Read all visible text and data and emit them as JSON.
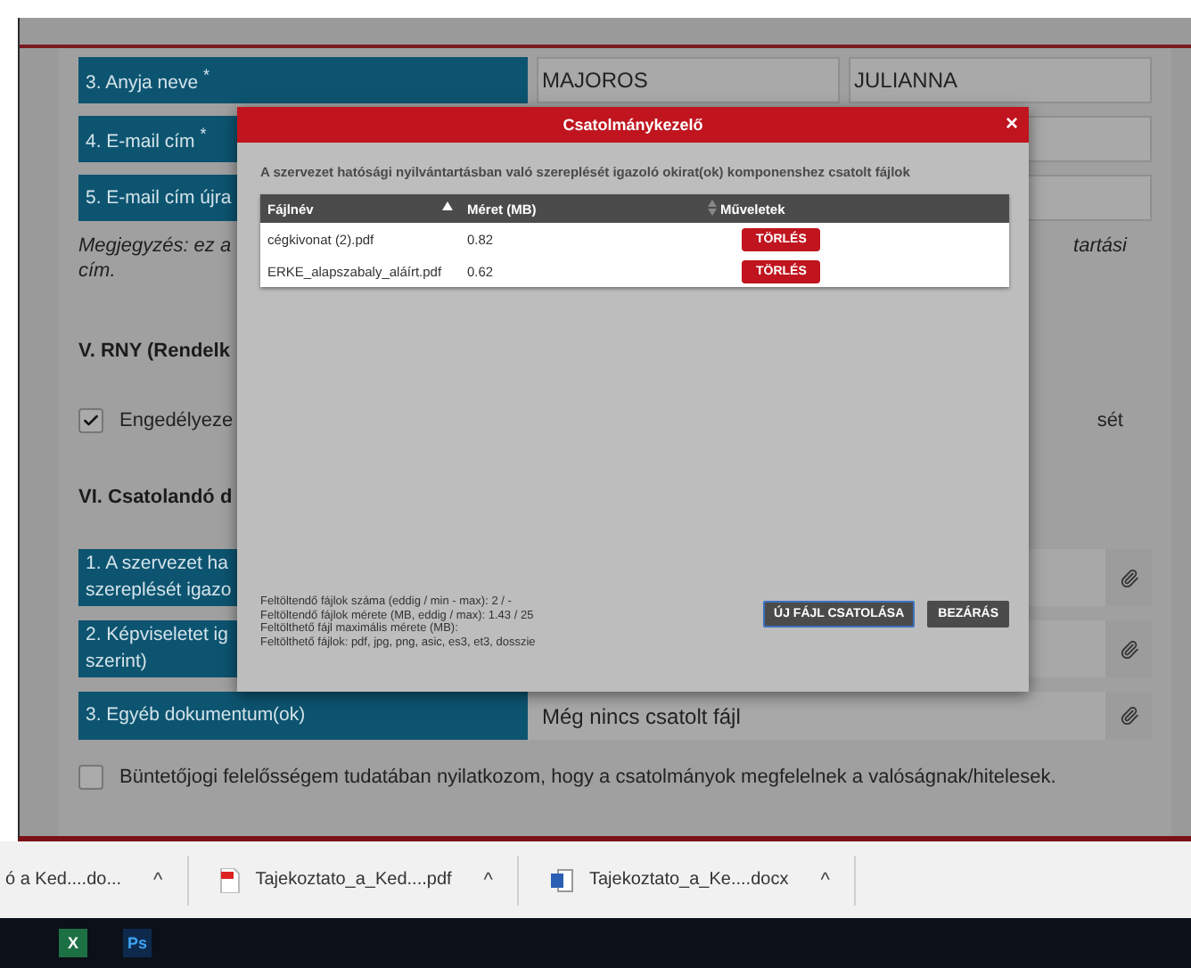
{
  "form": {
    "person_rows": [
      {
        "label": "3. Anyja neve",
        "required_mark": "*",
        "fields": [
          "MAJOROS",
          "JULIANNA"
        ]
      },
      {
        "label": "4. E-mail cím",
        "required_mark": "*"
      },
      {
        "label": "5. E-mail cím újra"
      }
    ],
    "note": {
      "left": "Megjegyzés: ez a",
      "right": "tartási",
      "second_line": "cím."
    },
    "section_5": "V. RNY (Rendelk",
    "consent": {
      "left": "Engedélyeze",
      "right": "sét",
      "checked": true
    },
    "section_6": "VI. Csatolandó d",
    "attachments": [
      {
        "label_lines": [
          "1. A szervezet ha",
          "szereplését igazo"
        ]
      },
      {
        "label_lines": [
          "2. Képviseletet ig",
          "szerint)"
        ]
      },
      {
        "label_lines": [
          "3. Egyéb dokumentum(ok)"
        ],
        "status": "Még nincs csatolt fájl"
      }
    ],
    "declaration": {
      "text": "Büntetőjogi felelősségem tudatában nyilatkozom, hogy a csatolmányok megfelelnek a valóságnak/hitelesek.",
      "checked": false
    }
  },
  "dialog": {
    "title": "Csatolmánykezelő",
    "close": "×",
    "description": "A szervezet hatósági nyilvántartásban való szereplését igazoló okirat(ok) komponenshez csatolt fájlok",
    "columns": [
      {
        "label": "Fájlnév",
        "sorted": true,
        "sortable": true
      },
      {
        "label": "Méret (MB)",
        "sorted": false,
        "sortable": true
      },
      {
        "label": "Műveletek",
        "sortable": false
      }
    ],
    "rows": [
      {
        "file": "cégkivonat (2).pdf",
        "size": "0.82",
        "action": "TÖRLÉS"
      },
      {
        "file": "ERKE_alapszabaly_aláírt.pdf",
        "size": "0.62",
        "action": "TÖRLÉS"
      }
    ],
    "info_lines": [
      "Feltöltendő fájlok száma (eddig / min - max): 2 / -",
      "Feltöltendő fájlok mérete (MB, eddig / max): 1.43 / 25",
      "Feltölthető fájl maximális mérete (MB):",
      "Feltölthető fájlok: pdf, jpg, png, asic, es3, et3, dosszie"
    ],
    "buttons": [
      {
        "label": "ÚJ FÁJL CSATOLÁSA",
        "focused": true
      },
      {
        "label": "BEZÁRÁS",
        "focused": false
      }
    ]
  },
  "downloads": [
    {
      "name": "ó a Ked....do...",
      "caret": "^",
      "kind": "partial"
    },
    {
      "name": "Tajekoztato_a_Ked....pdf",
      "caret": "^",
      "kind": "pdf"
    },
    {
      "name": "Tajekoztato_a_Ke....docx",
      "caret": "^",
      "kind": "word"
    }
  ],
  "taskbar": [
    {
      "label": "X",
      "kind": "excel"
    },
    {
      "label": "Ps",
      "kind": "photoshop"
    }
  ]
}
